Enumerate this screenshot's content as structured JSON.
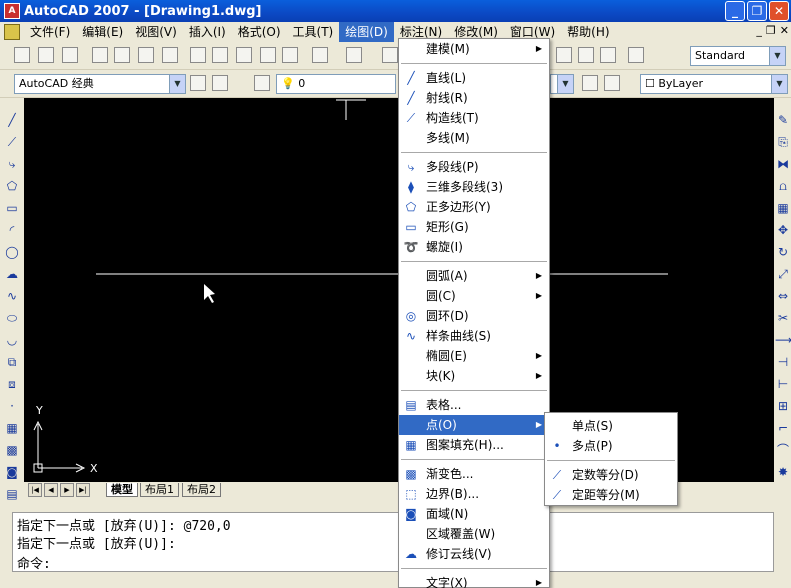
{
  "titlebar": {
    "title": "AutoCAD 2007 - [Drawing1.dwg]"
  },
  "menubar": {
    "items": [
      {
        "label": "文件(F)"
      },
      {
        "label": "编辑(E)"
      },
      {
        "label": "视图(V)"
      },
      {
        "label": "插入(I)"
      },
      {
        "label": "格式(O)"
      },
      {
        "label": "工具(T)"
      },
      {
        "label": "绘图(D)"
      },
      {
        "label": "标注(N)"
      },
      {
        "label": "修改(M)"
      },
      {
        "label": "窗口(W)"
      },
      {
        "label": "帮助(H)"
      }
    ]
  },
  "toolbar": {
    "workspace": "AutoCAD 经典",
    "layer_value": "0",
    "text_style": "Standard",
    "linetype": "ByLayer"
  },
  "canvas": {
    "y_axis": "Y",
    "x_axis": "X"
  },
  "tabs": {
    "model": "模型",
    "layout1": "布局1",
    "layout2": "布局2"
  },
  "command": {
    "lines": [
      "指定下一点或 [放弃(U)]: @720,0",
      "指定下一点或 [放弃(U)]:",
      "命令:"
    ]
  },
  "draw_menu": {
    "items": [
      {
        "label": "建模(M)",
        "icon": "none",
        "sub": true
      },
      {
        "label": "直线(L)",
        "icon": "line-icon"
      },
      {
        "label": "射线(R)",
        "icon": "ray-icon"
      },
      {
        "label": "构造线(T)",
        "icon": "xline-icon"
      },
      {
        "label": "多线(M)",
        "icon": "none"
      },
      {
        "label": "多段线(P)",
        "icon": "polyline-icon"
      },
      {
        "label": "三维多段线(3)",
        "icon": "3dpoly-icon"
      },
      {
        "label": "正多边形(Y)",
        "icon": "polygon-icon"
      },
      {
        "label": "矩形(G)",
        "icon": "rectangle-icon"
      },
      {
        "label": "螺旋(I)",
        "icon": "helix-icon"
      },
      {
        "label": "圆弧(A)",
        "icon": "none",
        "sub": true
      },
      {
        "label": "圆(C)",
        "icon": "none",
        "sub": true
      },
      {
        "label": "圆环(D)",
        "icon": "donut-icon"
      },
      {
        "label": "样条曲线(S)",
        "icon": "spline-icon"
      },
      {
        "label": "椭圆(E)",
        "icon": "none",
        "sub": true
      },
      {
        "label": "块(K)",
        "icon": "none",
        "sub": true
      },
      {
        "label": "表格...",
        "icon": "table-icon"
      },
      {
        "label": "点(O)",
        "icon": "none",
        "sub": true
      },
      {
        "label": "图案填充(H)...",
        "icon": "hatch-icon"
      },
      {
        "label": "渐变色...",
        "icon": "gradient-icon"
      },
      {
        "label": "边界(B)...",
        "icon": "boundary-icon"
      },
      {
        "label": "面域(N)",
        "icon": "region-icon"
      },
      {
        "label": "区域覆盖(W)",
        "icon": "none"
      },
      {
        "label": "修订云线(V)",
        "icon": "revcloud-icon"
      },
      {
        "label": "文字(X)",
        "icon": "none",
        "sub": true
      }
    ]
  },
  "point_menu": {
    "items": [
      {
        "label": "单点(S)",
        "icon": "none"
      },
      {
        "label": "多点(P)",
        "icon": "point-icon"
      },
      {
        "label": "定数等分(D)",
        "icon": "divide-icon"
      },
      {
        "label": "定距等分(M)",
        "icon": "measure-icon"
      }
    ]
  }
}
